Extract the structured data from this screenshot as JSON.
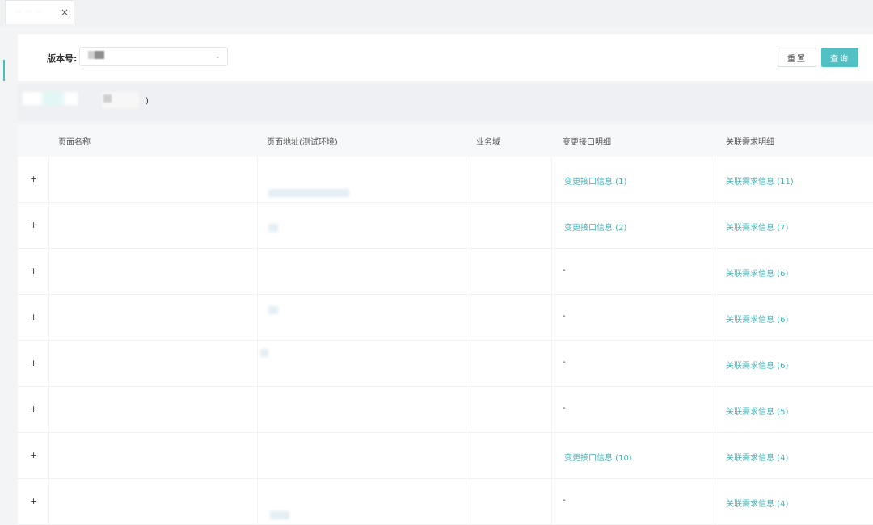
{
  "tabs": [
    {
      "label": "·· ·· ··",
      "close": "×"
    }
  ],
  "filter": {
    "version_label": "版本号:",
    "chevron": "⌄",
    "reset_label": "重置",
    "query_label": "查询"
  },
  "toolbar": {
    "paren": ")"
  },
  "table": {
    "headers": [
      "页面名称",
      "页面地址(测试环境)",
      "业务域",
      "变更接口明细",
      "关联需求明细"
    ],
    "rows": [
      {
        "expand": "+",
        "interface": "变更接口信息 (1)",
        "requirement": "关联需求信息 (11)"
      },
      {
        "expand": "+",
        "interface": "变更接口信息 (2)",
        "requirement": "关联需求信息 (7)"
      },
      {
        "expand": "+",
        "interface": "-",
        "requirement": "关联需求信息 (6)"
      },
      {
        "expand": "+",
        "interface": "-",
        "requirement": "关联需求信息 (6)"
      },
      {
        "expand": "+",
        "interface": "-",
        "requirement": "关联需求信息 (6)"
      },
      {
        "expand": "+",
        "interface": "-",
        "requirement": "关联需求信息 (5)"
      },
      {
        "expand": "+",
        "interface": "变更接口信息 (10)",
        "requirement": "关联需求信息 (4)"
      },
      {
        "expand": "+",
        "interface": "-",
        "requirement": "关联需求信息 (4)"
      }
    ]
  },
  "colors": {
    "accent": "#52c1c4",
    "link": "#45b1b5"
  }
}
